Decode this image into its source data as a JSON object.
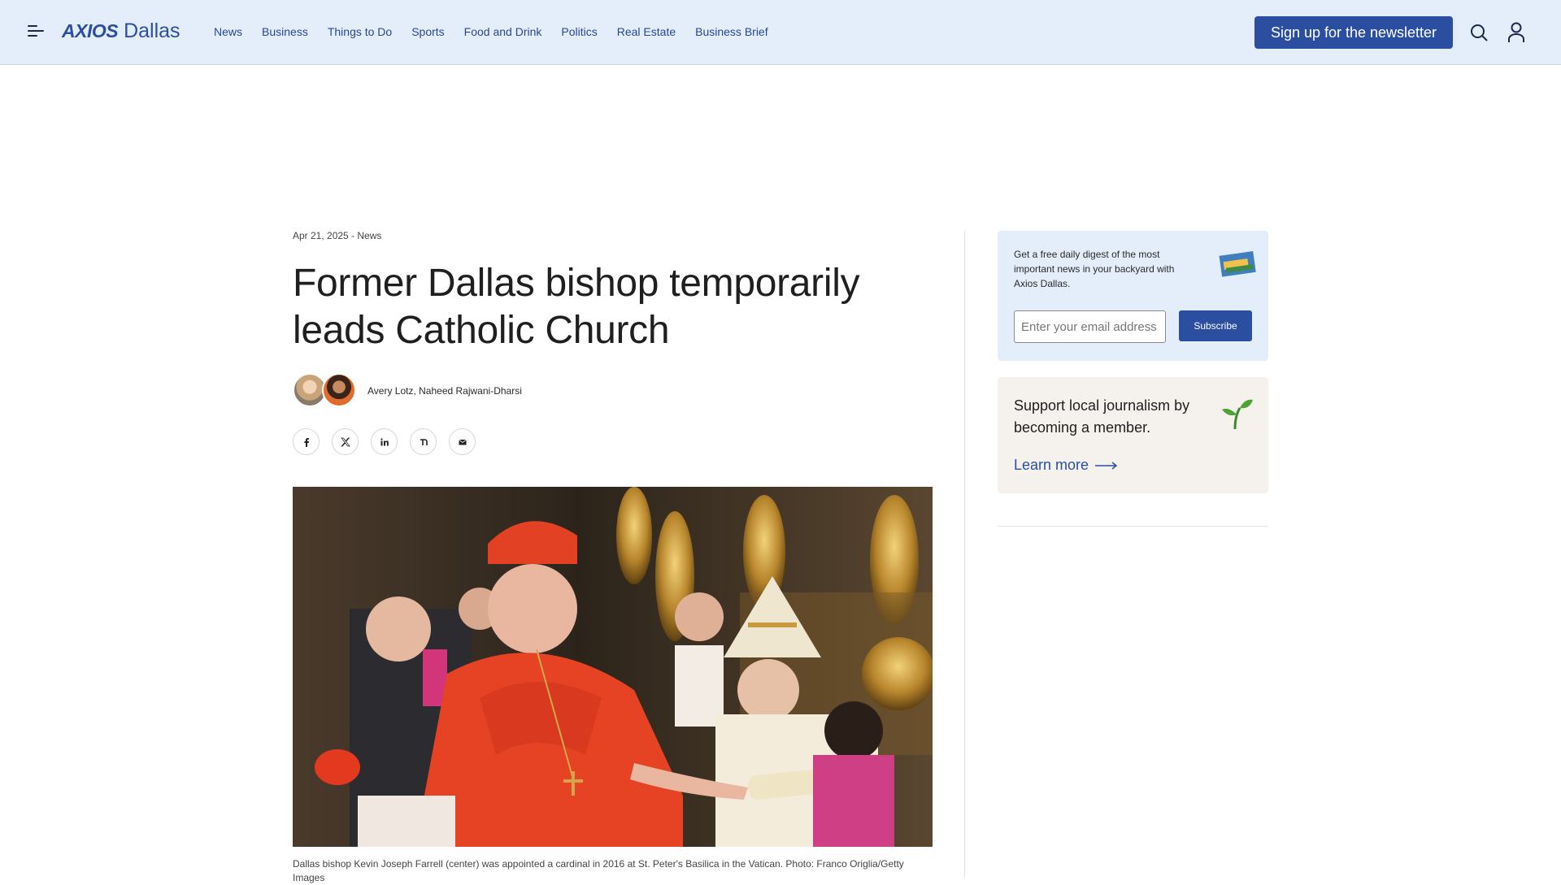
{
  "header": {
    "logo_brand": "AXIOS",
    "logo_city": "Dallas",
    "nav": [
      "News",
      "Business",
      "Things to Do",
      "Sports",
      "Food and Drink",
      "Politics",
      "Real Estate",
      "Business Brief"
    ],
    "signup_label": "Sign up for the newsletter",
    "accent_color": "#2b4ea0"
  },
  "article": {
    "meta": "Apr 21, 2025 - News",
    "title": "Former Dallas bishop temporarily leads Catholic Church",
    "authors": "Avery Lotz, Naheed Rajwani-Dharsi",
    "share": [
      "facebook-icon",
      "x-icon",
      "linkedin-icon",
      "threads-icon",
      "email-icon"
    ],
    "caption": "Dallas bishop Kevin Joseph Farrell (center) was appointed a cardinal in 2016 at St. Peter's Basilica in the Vatican. Photo: Franco Origlia/Getty Images"
  },
  "sidebar": {
    "newsletter_text": "Get a free daily digest of the most important news in your backyard with Axios Dallas.",
    "email_placeholder": "Enter your email address",
    "subscribe_label": "Subscribe",
    "member_text": "Support local journalism by becoming a member.",
    "learn_more": "Learn more"
  }
}
